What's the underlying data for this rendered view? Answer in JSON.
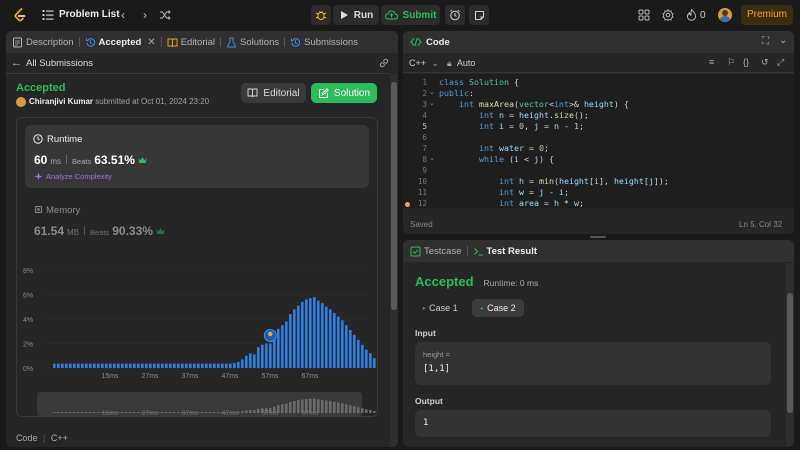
{
  "topbar": {
    "title": "Problem List",
    "run_label": "Run",
    "submit_label": "Submit",
    "streak_count": "0",
    "premium_label": "Premium"
  },
  "left_tabs": [
    {
      "label": "Description"
    },
    {
      "label": "Accepted"
    },
    {
      "label": "Editorial"
    },
    {
      "label": "Solutions"
    },
    {
      "label": "Submissions"
    }
  ],
  "submission": {
    "back_label": "All Submissions",
    "status": "Accepted",
    "author": "Chiranjivi Kumar",
    "submitted_text": "submitted at Oct 01, 2024 23:20",
    "editorial_btn": "Editorial",
    "solution_btn": "Solution",
    "runtime_title": "Runtime",
    "runtime_value": "60",
    "runtime_unit": "ms",
    "runtime_beats_label": "Beats",
    "runtime_beats": "63.51%",
    "analyze_label": "Analyze Complexity",
    "memory_title": "Memory",
    "memory_value": "61.54",
    "memory_unit": "MB",
    "memory_beats_label": "Beats",
    "memory_beats": "90.33%",
    "code_label": "Code",
    "code_lang": "C++"
  },
  "chart_data": {
    "type": "bar",
    "y_ticks": [
      "8%",
      "6%",
      "4%",
      "2%",
      "0%"
    ],
    "x_ticks": [
      "15ms",
      "27ms",
      "37ms",
      "47ms",
      "57ms",
      "67ms"
    ],
    "ylim": [
      0,
      8
    ],
    "values": [
      0.35,
      0.35,
      0.35,
      0.35,
      0.35,
      0.35,
      0.35,
      0.35,
      0.35,
      0.35,
      0.35,
      0.35,
      0.35,
      0.35,
      0.35,
      0.35,
      0.35,
      0.35,
      0.35,
      0.35,
      0.35,
      0.35,
      0.35,
      0.35,
      0.35,
      0.35,
      0.35,
      0.35,
      0.35,
      0.35,
      0.35,
      0.35,
      0.35,
      0.35,
      0.35,
      0.35,
      0.35,
      0.35,
      0.35,
      0.35,
      0.35,
      0.35,
      0.35,
      0.35,
      0.35,
      0.4,
      0.5,
      0.7,
      1.0,
      1.2,
      1.1,
      1.7,
      1.9,
      2.0,
      2.0,
      2.5,
      3.2,
      3.5,
      3.8,
      4.4,
      4.8,
      5.1,
      5.4,
      5.6,
      5.7,
      5.8,
      5.5,
      5.3,
      5.0,
      4.8,
      4.5,
      4.2,
      3.9,
      3.5,
      3.1,
      2.7,
      2.3,
      1.9,
      1.5,
      1.2,
      0.8
    ],
    "highlight_index": 54,
    "bar_color": "#2f7fe3"
  },
  "code_panel": {
    "title": "Code",
    "lang": "C++",
    "mode": "Auto",
    "status_left": "Saved",
    "status_right": "Ln 5, Col 32",
    "line_numbers": [
      "1",
      "2",
      "3",
      "4",
      "5",
      "6",
      "7",
      "8",
      "9",
      "10",
      "11",
      "12"
    ]
  },
  "result_panel": {
    "tab_testcase": "Testcase",
    "tab_result": "Test Result",
    "status": "Accepted",
    "runtime": "Runtime: 0 ms",
    "case1": "Case 1",
    "case2": "Case 2",
    "input_label": "Input",
    "param_name": "height =",
    "param_value": "[1,1]",
    "output_label": "Output",
    "output_value": "1"
  },
  "colors": {
    "accent_green": "#2cbb5d",
    "premium": "#ffa116",
    "bar_blue": "#2f7fe3"
  }
}
